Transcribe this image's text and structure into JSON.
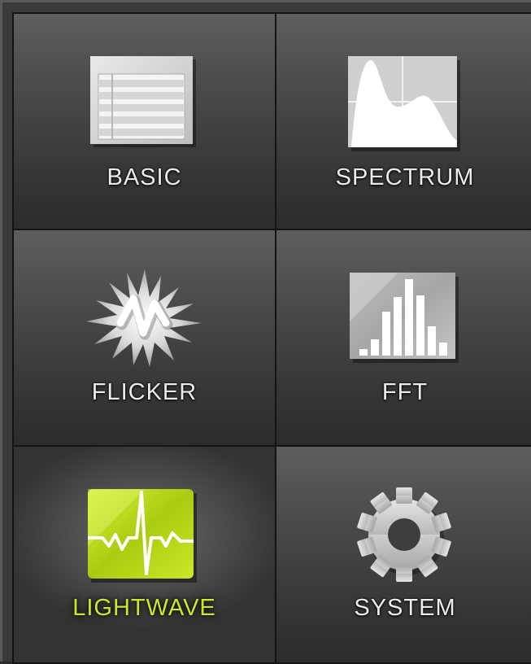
{
  "menu": {
    "tiles": [
      {
        "label": "BASIC",
        "icon": "basic-list-icon",
        "active": false
      },
      {
        "label": "SPECTRUM",
        "icon": "spectrum-graph-icon",
        "active": false
      },
      {
        "label": "FLICKER",
        "icon": "flicker-burst-icon",
        "active": false
      },
      {
        "label": "FFT",
        "icon": "fft-bars-icon",
        "active": false
      },
      {
        "label": "LIGHTWAVE",
        "icon": "lightwave-pulse-icon",
        "active": true
      },
      {
        "label": "SYSTEM",
        "icon": "gear-icon",
        "active": false
      }
    ]
  },
  "colors": {
    "active_accent": "#c6ea2a",
    "label_default": "#ececec",
    "tile_background": "#4a4a4a",
    "divider": "#141414"
  }
}
